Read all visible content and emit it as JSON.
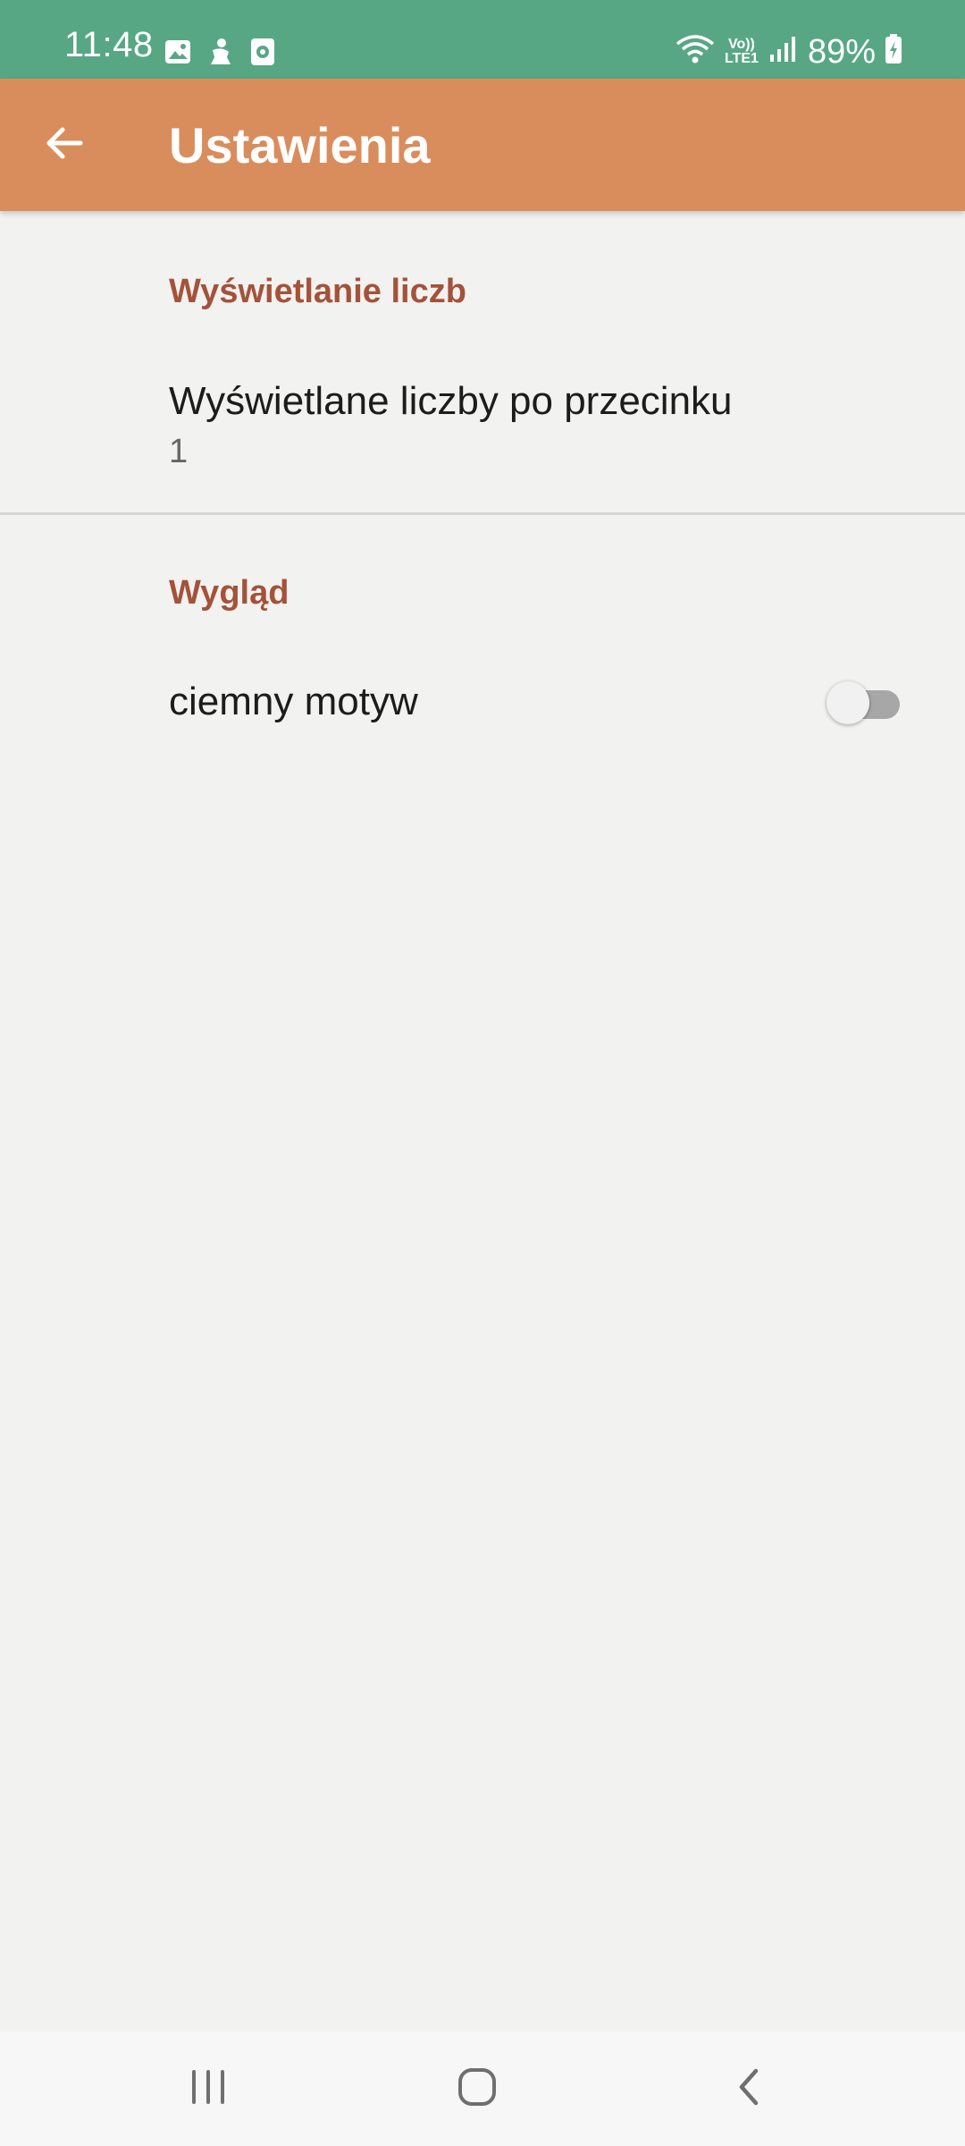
{
  "status_bar": {
    "time": "11:48",
    "network_label": "LTE1",
    "battery_percent": "89%",
    "icons": [
      "image-icon",
      "notification-app-icon",
      "screen-recorder-icon",
      "wifi-icon",
      "volte-icon",
      "signal-icon",
      "battery-charging-icon"
    ]
  },
  "app_bar": {
    "title": "Ustawienia",
    "back_icon": "arrow-back-icon"
  },
  "sections": [
    {
      "header": "Wyświetlanie liczb",
      "items": [
        {
          "title": "Wyświetlane liczby po przecinku",
          "summary": "1"
        }
      ]
    },
    {
      "header": "Wygląd",
      "items": [
        {
          "title": "ciemny motyw",
          "switch_on": false
        }
      ]
    }
  ],
  "colors": {
    "status_bar": "#58a784",
    "app_bar": "#d98d5c",
    "section_header": "#a4523a",
    "background": "#f2f2f0"
  },
  "navigation": {
    "icons": [
      "recent-apps-icon",
      "home-icon",
      "back-icon"
    ]
  }
}
